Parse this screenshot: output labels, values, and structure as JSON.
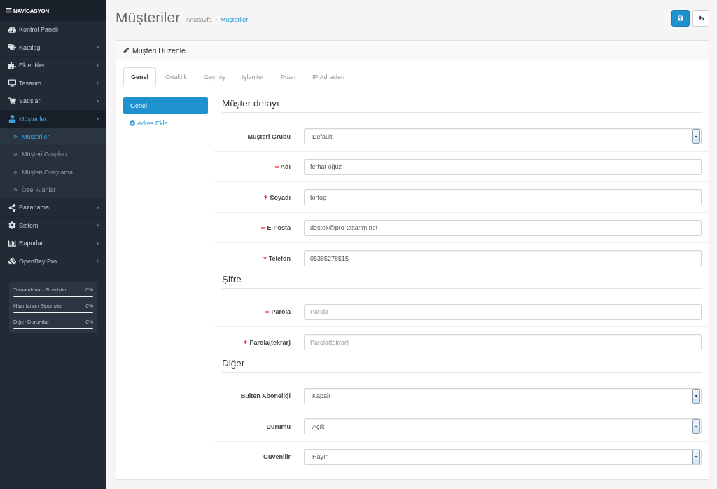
{
  "sidebar": {
    "title": "NAVİGASYON",
    "items": [
      {
        "label": "Kontrol Paneli",
        "selected": false,
        "expandable": false,
        "expanded": false
      },
      {
        "label": "Katalog",
        "selected": false,
        "expandable": true,
        "expanded": false
      },
      {
        "label": "Eklentiler",
        "selected": false,
        "expandable": true,
        "expanded": false
      },
      {
        "label": "Tasarım",
        "selected": false,
        "expandable": true,
        "expanded": false
      },
      {
        "label": "Satışlar",
        "selected": false,
        "expandable": true,
        "expanded": false
      },
      {
        "label": "Müşteriler",
        "selected": true,
        "expandable": true,
        "expanded": true,
        "children": [
          {
            "label": "Müşteriler",
            "selected": true
          },
          {
            "label": "Müşteri Grupları",
            "selected": false
          },
          {
            "label": "Müşteri Onaylama",
            "selected": false
          },
          {
            "label": "Özel Alanlar",
            "selected": false
          }
        ]
      },
      {
        "label": "Pazarlama",
        "selected": false,
        "expandable": true,
        "expanded": false
      },
      {
        "label": "Sistem",
        "selected": false,
        "expandable": true,
        "expanded": false
      },
      {
        "label": "Raporlar",
        "selected": false,
        "expandable": true,
        "expanded": false
      },
      {
        "label": "OpenBay Pro",
        "selected": false,
        "expandable": true,
        "expanded": false
      }
    ],
    "stats": [
      {
        "label": "Tamamlanan Siparişler",
        "reading": "0%",
        "level": 0
      },
      {
        "label": "Hazırlanan Siparişler",
        "reading": "0%",
        "level": 0
      },
      {
        "label": "Diğer Durumlar",
        "reading": "0%",
        "level": 0
      }
    ]
  },
  "header": {
    "title": "Müşteriler",
    "breadcrumb": [
      {
        "label": "Anasayfa",
        "current": false
      },
      {
        "label": "Müşteriler",
        "current": true
      }
    ]
  },
  "panel": {
    "title": "Müşteri Düzenle",
    "tabs": [
      {
        "label": "Genel",
        "selected": true
      },
      {
        "label": "Ortaklık",
        "selected": false
      },
      {
        "label": "Geçmiş",
        "selected": false
      },
      {
        "label": "İşlemler",
        "selected": false
      },
      {
        "label": "Puan",
        "selected": false
      },
      {
        "label": "IP Adresleri",
        "selected": false
      }
    ],
    "address_tabs": [
      {
        "label": "Genel",
        "selected": true
      }
    ],
    "add_address": "Adres Ekle",
    "sections": [
      {
        "title": "Müşter detayı",
        "fields": [
          {
            "kind": "select",
            "label": "Müşteri Grubu",
            "required": false,
            "value": "Default"
          },
          {
            "kind": "text",
            "label": "Adı",
            "required": true,
            "value": "ferhat oğuz"
          },
          {
            "kind": "text",
            "label": "Soyadı",
            "required": true,
            "value": "tortop"
          },
          {
            "kind": "text",
            "label": "E-Posta",
            "required": true,
            "value": "destek@pro-tasarim.net"
          },
          {
            "kind": "text",
            "label": "Telefon",
            "required": true,
            "value": "05385278515"
          }
        ]
      },
      {
        "title": "Şifre",
        "fields": [
          {
            "kind": "password",
            "label": "Parola",
            "required": true,
            "placeholder": "Parola"
          },
          {
            "kind": "password",
            "label": "Parola(tekrar)",
            "required": true,
            "placeholder": "Parola(tekrar)"
          }
        ]
      },
      {
        "title": "Diğer",
        "fields": [
          {
            "kind": "select",
            "label": "Bülten Aboneliği",
            "required": false,
            "value": "Kapalı"
          },
          {
            "kind": "select",
            "label": "Durumu",
            "required": false,
            "value": "Açık"
          },
          {
            "kind": "select",
            "label": "Güvenilir",
            "required": false,
            "value": "Hayır"
          }
        ]
      }
    ]
  }
}
